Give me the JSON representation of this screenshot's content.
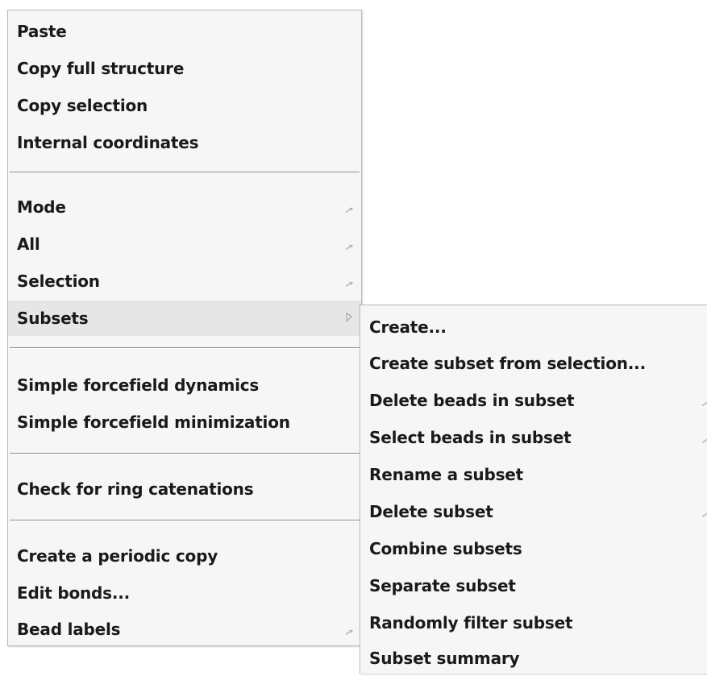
{
  "main_menu": {
    "items": [
      {
        "label": "Paste"
      },
      {
        "label": "Copy full structure"
      },
      {
        "label": "Copy selection"
      },
      {
        "label": "Internal coordinates"
      },
      {
        "label": "Mode"
      },
      {
        "label": "All"
      },
      {
        "label": "Selection"
      },
      {
        "label": "Subsets"
      },
      {
        "label": "Simple forcefield dynamics"
      },
      {
        "label": "Simple forcefield minimization"
      },
      {
        "label": "Check for ring catenations"
      },
      {
        "label": "Create a periodic copy"
      },
      {
        "label": "Edit bonds..."
      },
      {
        "label": "Bead labels"
      }
    ]
  },
  "submenu": {
    "items": [
      {
        "label": "Create..."
      },
      {
        "label": "Create subset from selection..."
      },
      {
        "label": "Delete beads in subset"
      },
      {
        "label": "Select beads in subset"
      },
      {
        "label": "Rename a subset"
      },
      {
        "label": "Delete subset"
      },
      {
        "label": "Combine subsets"
      },
      {
        "label": "Separate subset"
      },
      {
        "label": "Randomly filter subset"
      },
      {
        "label": "Subset summary"
      }
    ]
  },
  "colors": {
    "menu_bg": "#f6f6f6",
    "highlight_bg": "#e6e6e6",
    "text": "#1a1a1a",
    "separator": "#8c8c8c"
  }
}
